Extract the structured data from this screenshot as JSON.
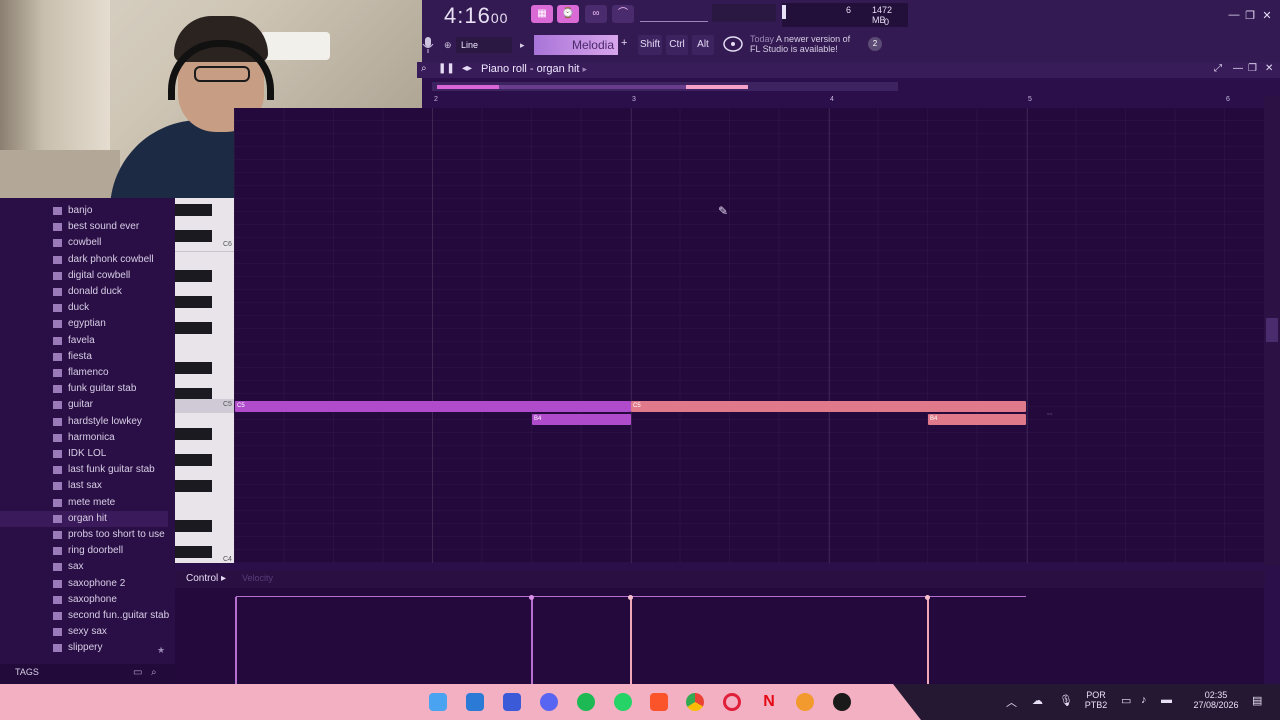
{
  "transport": {
    "time_main": "4:16",
    "time_sub": "00"
  },
  "system": {
    "cpu_count": "6",
    "memory": "1472 MB",
    "polyphony": "0"
  },
  "toolbar": {
    "input_mode": "Line",
    "pattern_name": "Melodia",
    "plus_label": "+",
    "shift_label": "Shift",
    "ctrl_label": "Ctrl",
    "alt_label": "Alt",
    "news_date": "Today",
    "news_line1": "A newer version of",
    "news_line2": "FL Studio is available!",
    "news_badge": "2"
  },
  "piano_roll": {
    "title": "Piano roll - organ hit",
    "ruler": [
      "2",
      "3",
      "4",
      "5",
      "6"
    ],
    "key_labels": {
      "c6": "C6",
      "c5": "C5",
      "c4": "C4"
    },
    "notes": [
      {
        "label": "C5"
      },
      {
        "label": "C5"
      },
      {
        "label": "B4"
      },
      {
        "label": "B4"
      }
    ]
  },
  "browser": {
    "items": [
      "banjo",
      "best sound ever",
      "cowbell",
      "dark phonk cowbell",
      "digital cowbell",
      "donald duck",
      "duck",
      "egyptian",
      "favela",
      "fiesta",
      "flamenco",
      "funk guitar stab",
      "guitar",
      "hardstyle lowkey",
      "harmonica",
      "IDK LOL",
      "last funk guitar stab",
      "last sax",
      "mete mete",
      "organ hit",
      "probs too short to use",
      "ring doorbell",
      "sax",
      "saxophone 2",
      "saxophone",
      "second fun..guitar stab",
      "sexy sax",
      "slippery"
    ],
    "selected": "organ hit",
    "tags_label": "TAGS"
  },
  "control": {
    "label": "Control",
    "property": "Velocity"
  },
  "taskbar": {
    "lang_1": "POR",
    "lang_2": "PTB2",
    "clock_time": "02:35",
    "clock_date": "27/08/2026"
  },
  "colors": {
    "accent_pink": "#d964d6",
    "note_purple": "#b04ccc",
    "note_salmon": "#e07a8a",
    "background": "#24093d",
    "taskbar": "#f3b0c2"
  }
}
